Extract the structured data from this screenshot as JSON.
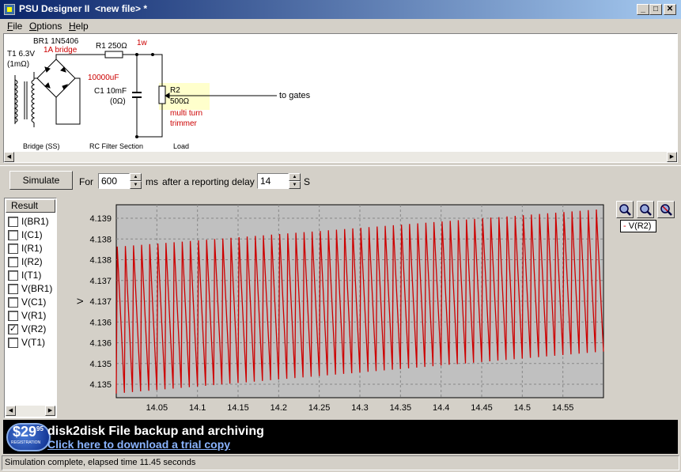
{
  "window": {
    "title": "PSU Designer II  <new file> *"
  },
  "window_buttons": {
    "minimize": "_",
    "maximize": "□",
    "close": "✕"
  },
  "menu": [
    {
      "accel": "F",
      "rest": "ile"
    },
    {
      "accel": "O",
      "rest": "ptions"
    },
    {
      "accel": "H",
      "rest": "elp"
    }
  ],
  "circuit": {
    "t1_label": "T1 6.3V",
    "t1_sub": "(1mΩ)",
    "br1_label": "BR1 1N5406",
    "br1_note": "1A bridge",
    "r1_label": "R1 250Ω",
    "r1_note": "1w",
    "c1_note": "10000uF",
    "c1_label": "C1 10mF",
    "c1_sub": "(0Ω)",
    "r2_label": "R2",
    "r2_value": "500Ω",
    "r2_note1": "multi turn",
    "r2_note2": "trimmer",
    "out_label": "to gates",
    "section_bridge": "Bridge (SS)",
    "section_filter": "RC Filter Section",
    "section_load": "Load",
    "note_color": "#cc0000",
    "highlight_color": "#ffffcc"
  },
  "simbar": {
    "simulate_label": "Simulate",
    "for_label": "For",
    "duration_value": "600",
    "duration_unit": "ms",
    "delay_label": "after a reporting delay of",
    "delay_value": "14",
    "delay_unit": "S"
  },
  "results": {
    "header": "Result",
    "items": [
      {
        "label": "I(BR1)",
        "checked": false
      },
      {
        "label": "I(C1)",
        "checked": false
      },
      {
        "label": "I(R1)",
        "checked": false
      },
      {
        "label": "I(R2)",
        "checked": false
      },
      {
        "label": "I(T1)",
        "checked": false
      },
      {
        "label": "V(BR1)",
        "checked": false
      },
      {
        "label": "V(C1)",
        "checked": false
      },
      {
        "label": "V(R1)",
        "checked": false
      },
      {
        "label": "V(R2)",
        "checked": true
      },
      {
        "label": "V(T1)",
        "checked": false
      }
    ]
  },
  "legend": {
    "entry": "V(R2)",
    "marker": "-"
  },
  "zoom_buttons": [
    "zoom-in-icon",
    "zoom-out-icon",
    "zoom-reset-icon"
  ],
  "chart_data": {
    "type": "line",
    "title": "",
    "xlabel": "",
    "ylabel": "V",
    "series": [
      {
        "name": "V(R2)",
        "color": "#cc0000",
        "x_start": 14.0,
        "x_end": 14.6,
        "cycles": 60,
        "peak_start": 4.1383,
        "peak_end": 4.1392,
        "trough_start": 4.1348,
        "trough_end": 4.1358
      }
    ],
    "xlim": [
      14.0,
      14.6
    ],
    "ylim": [
      4.1347,
      4.1393
    ],
    "x_ticks": [
      "14.05",
      "14.1",
      "14.15",
      "14.2",
      "14.25",
      "14.3",
      "14.35",
      "14.4",
      "14.45",
      "14.5",
      "14.55"
    ],
    "y_ticks": [
      "4.139",
      "4.138",
      "4.138",
      "4.137",
      "4.137",
      "4.136",
      "4.136",
      "4.135",
      "4.135"
    ],
    "grid": true,
    "legend_position": "top-right",
    "plot_bg": "#c0c0c0"
  },
  "banner": {
    "price": "$29",
    "cents": "95",
    "reg": "REGISTRATION",
    "headline": "disk2disk File backup and archiving",
    "link": "Click here to download a trial copy"
  },
  "status": {
    "text": "Simulation complete, elapsed time 11.45 seconds"
  }
}
